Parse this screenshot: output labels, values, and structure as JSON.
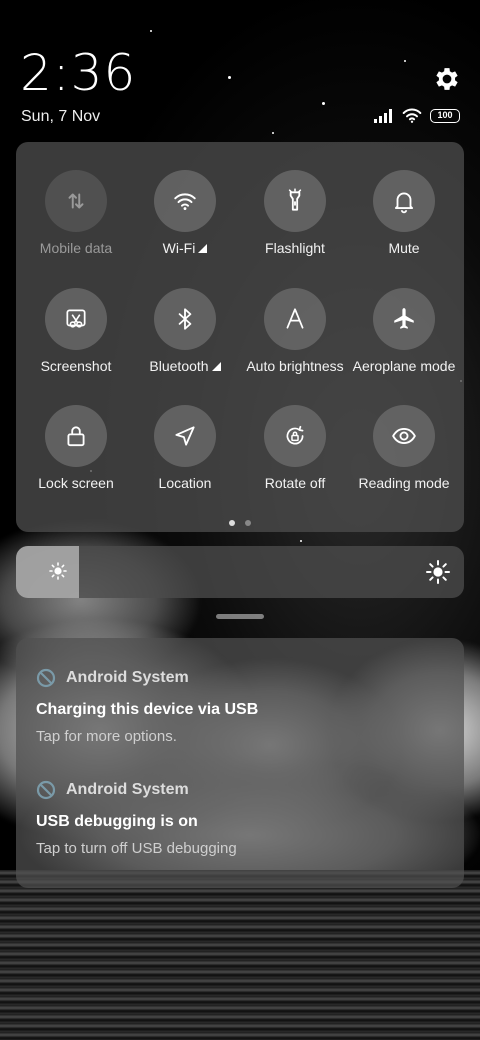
{
  "status": {
    "time": "2:36",
    "date": "Sun, 7 Nov",
    "battery": "100"
  },
  "quick_settings": {
    "tiles": [
      {
        "label": "Mobile data",
        "icon": "mobile-data-icon",
        "active": false,
        "indicator": false
      },
      {
        "label": "Wi-Fi",
        "icon": "wifi-icon",
        "active": true,
        "indicator": true
      },
      {
        "label": "Flashlight",
        "icon": "flashlight-icon",
        "active": true,
        "indicator": false
      },
      {
        "label": "Mute",
        "icon": "bell-icon",
        "active": true,
        "indicator": false
      },
      {
        "label": "Screenshot",
        "icon": "screenshot-icon",
        "active": true,
        "indicator": false
      },
      {
        "label": "Bluetooth",
        "icon": "bluetooth-icon",
        "active": true,
        "indicator": true
      },
      {
        "label": "Auto brightness",
        "icon": "auto-brightness-icon",
        "active": true,
        "indicator": false
      },
      {
        "label": "Aeroplane mode",
        "icon": "aeroplane-icon",
        "active": true,
        "indicator": false
      },
      {
        "label": "Lock screen",
        "icon": "lock-icon",
        "active": true,
        "indicator": false
      },
      {
        "label": "Location",
        "icon": "location-icon",
        "active": true,
        "indicator": false
      },
      {
        "label": "Rotate off",
        "icon": "rotate-lock-icon",
        "active": true,
        "indicator": false
      },
      {
        "label": "Reading mode",
        "icon": "eye-icon",
        "active": true,
        "indicator": false
      }
    ],
    "pages": 2,
    "current_page": 1
  },
  "brightness": {
    "level": 0.14
  },
  "notifications": [
    {
      "app": "Android System",
      "title": "Charging this device via USB",
      "body": "Tap for more options."
    },
    {
      "app": "Android System",
      "title": "USB debugging is on",
      "body": "Tap to turn off USB debugging"
    }
  ]
}
